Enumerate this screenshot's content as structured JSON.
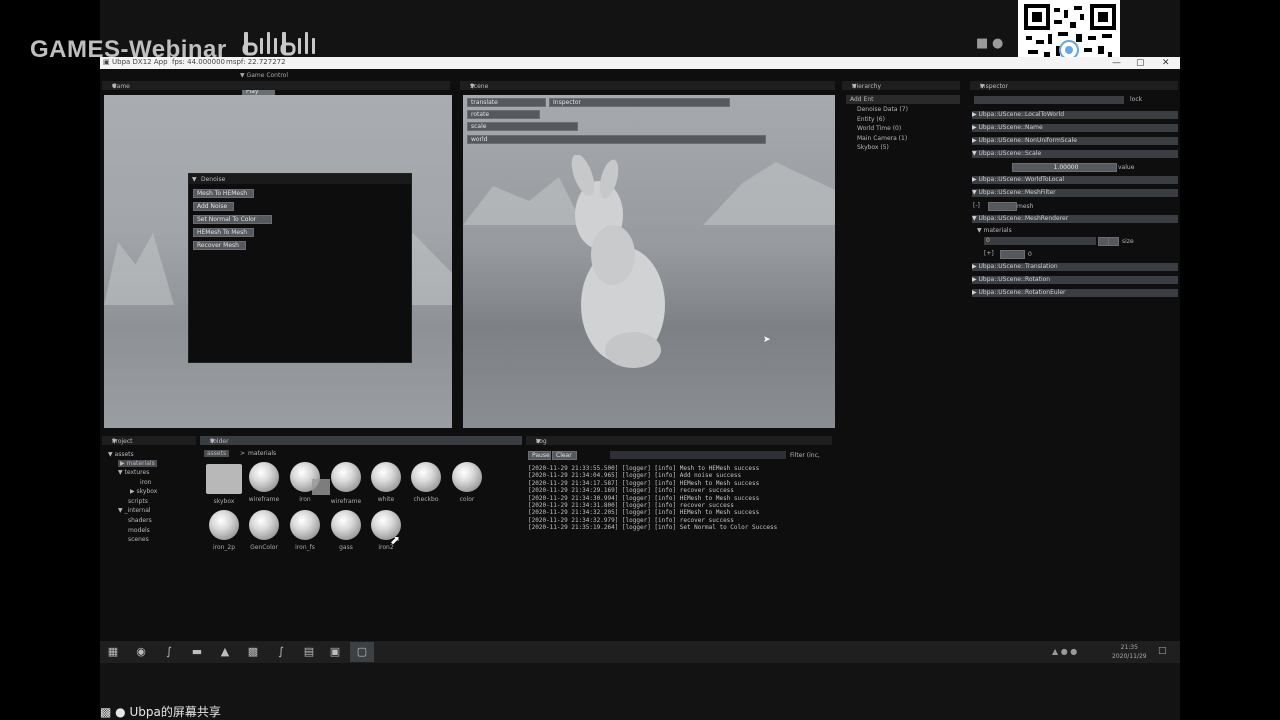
{
  "overlay": {
    "watermark": "GAMES-Webinar",
    "bili_logo": "bilibili",
    "share_label": "Ubpa的屏幕共享"
  },
  "titlebar": {
    "app": "Ubpa DX12 App",
    "fps": "fps: 44.000000",
    "mspf": "mspf: 22.727272",
    "controls": [
      "—",
      "▢",
      "✕"
    ]
  },
  "menu": {
    "game_control": "Game Control",
    "play": "Play"
  },
  "panels": {
    "game": "Game",
    "scene": "Scene",
    "hierarchy": "Hierarchy",
    "inspector": "Inspector",
    "project": "Project",
    "folder": "Folder",
    "log": "Log"
  },
  "denoise": {
    "title": "Denoise",
    "buttons": [
      "Mesh To HEMesh",
      "Add Noise",
      "Set Normal To Color",
      "HEMesh To Mesh",
      "Recover Mesh"
    ]
  },
  "scene_tools": {
    "buttons": [
      "translate",
      "rotate",
      "scale",
      "world"
    ],
    "mode": "Inspector"
  },
  "hierarchy": {
    "header": "Add Ent",
    "items": [
      "Denoise Data (7)",
      "Entity (6)",
      "World Time (0)",
      "Main Camera (1)",
      "Skybox (5)"
    ]
  },
  "inspector": {
    "lock": "lock",
    "components": [
      "Ubpa::UScene::LocalToWorld",
      "Ubpa::UScene::Name",
      "Ubpa::UScene::NonUniformScale",
      "Ubpa::UScene::Scale",
      "Ubpa::UScene::WorldToLocal",
      "Ubpa::UScene::MeshFilter",
      "Ubpa::UScene::MeshRenderer",
      "Ubpa::UScene::Translation",
      "Ubpa::UScene::Rotation",
      "Ubpa::UScene::RotationEuler"
    ],
    "scale_value": "1.00000",
    "value_label": "value",
    "mesh_label": "mesh",
    "materials_label": "materials",
    "size_label": "size",
    "zero": "0",
    "bracket_minus": "[-]",
    "bracket_plus": "[+]"
  },
  "project": {
    "tree": [
      "assets",
      "materials",
      "textures",
      "iron",
      "skybox",
      "scripts",
      "_internal",
      "shaders",
      "models",
      "scenes"
    ]
  },
  "folder": {
    "breadcrumb_root": "assets",
    "breadcrumb_sep": ">",
    "breadcrumb_current": "materials",
    "row1": [
      "skybox",
      "wireframe",
      "iron",
      "wireframe",
      "white",
      "checkbo",
      "color"
    ],
    "row2": [
      "iron_2p",
      "GenColor",
      "iron_fs",
      "gass",
      "iron2"
    ]
  },
  "log": {
    "tabs": [
      "Pause",
      "Clear"
    ],
    "filter": "Filter (inc,",
    "lines": [
      "[2020-11-29 21:33:55.500] [logger] [info] Mesh to HEMesh success",
      "[2020-11-29 21:34:04.965] [logger] [info] Add noise success",
      "[2020-11-29 21:34:17.587] [logger] [info] HEMesh to Mesh success",
      "[2020-11-29 21:34:29.169] [logger] [info] recover success",
      "[2020-11-29 21:34:30.994] [logger] [info] HEMesh to Mesh success",
      "[2020-11-29 21:34:31.800] [logger] [info] recover success",
      "[2020-11-29 21:34:32.205] [logger] [info] HEMesh to Mesh success",
      "[2020-11-29 21:34:32.979] [logger] [info] recover success",
      "[2020-11-29 21:35:19.264] [logger] [info] Set Normal to Color Success"
    ]
  },
  "taskbar": {
    "time": "21:35",
    "date": "2020/11/29"
  }
}
